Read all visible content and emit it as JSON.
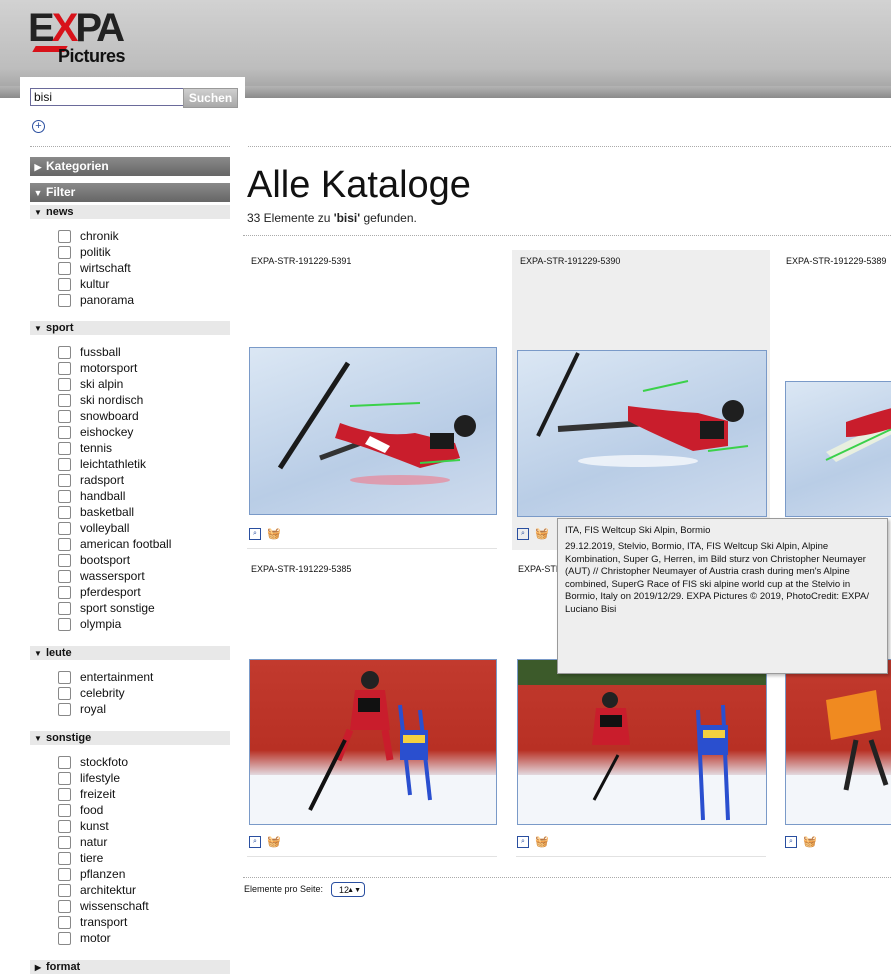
{
  "logo": {
    "top_text": "EXPA",
    "sub_text": "Pictures"
  },
  "search": {
    "value": "bisi",
    "button_label": "Suchen"
  },
  "sidebar": {
    "kategorien_label": "Kategorien",
    "filter_label": "Filter",
    "groups": [
      {
        "label": "news",
        "items": [
          "chronik",
          "politik",
          "wirtschaft",
          "kultur",
          "panorama"
        ]
      },
      {
        "label": "sport",
        "items": [
          "fussball",
          "motorsport",
          "ski alpin",
          "ski nordisch",
          "snowboard",
          "eishockey",
          "tennis",
          "leichtathletik",
          "radsport",
          "handball",
          "basketball",
          "volleyball",
          "american football",
          "bootsport",
          "wassersport",
          "pferdesport",
          "sport sonstige",
          "olympia"
        ]
      },
      {
        "label": "leute",
        "items": [
          "entertainment",
          "celebrity",
          "royal"
        ]
      },
      {
        "label": "sonstige",
        "items": [
          "stockfoto",
          "lifestyle",
          "freizeit",
          "food",
          "kunst",
          "natur",
          "tiere",
          "pflanzen",
          "architektur",
          "wissenschaft",
          "transport",
          "motor"
        ]
      },
      {
        "label": "format",
        "items": []
      }
    ]
  },
  "main": {
    "title": "Alle Kataloge",
    "result_prefix": "33 Elemente zu ",
    "result_term": "'bisi'",
    "result_suffix": " gefunden.",
    "cards": [
      {
        "id": "EXPA-STR-191229-5391"
      },
      {
        "id": "EXPA-STR-191229-5390"
      },
      {
        "id": "EXPA-STR-191229-5389"
      },
      {
        "id": "EXPA-STR-191229-5385"
      },
      {
        "id": "EXPA-STR"
      },
      {
        "id": ""
      }
    ],
    "per_page_label": "Elemente pro Seite:",
    "per_page_value": "12"
  },
  "tooltip": {
    "title": "ITA, FIS Weltcup Ski Alpin, Bormio",
    "body": "29.12.2019, Stelvio, Bormio, ITA, FIS Weltcup Ski Alpin, Alpine Kombination, Super G, Herren, im Bild sturz von Christopher Neumayer (AUT) // Christopher Neumayer of Austria crash during men's Alpine combined, SuperG Race of FIS ski alpine world cup at the Stelvio in Bormio, Italy on 2019/12/29. EXPA Pictures © 2019, PhotoCredit: EXPA/ Luciano Bisi"
  },
  "icons": {
    "add": "plus-circle-icon",
    "zoom": "zoom-icon",
    "basket": "basket-icon",
    "expand": "triangle-right-icon",
    "collapse": "triangle-down-icon"
  },
  "colors": {
    "brand_red": "#d8121a",
    "link_blue": "#2a4fa0",
    "header_gray": "#bdbdbd"
  }
}
